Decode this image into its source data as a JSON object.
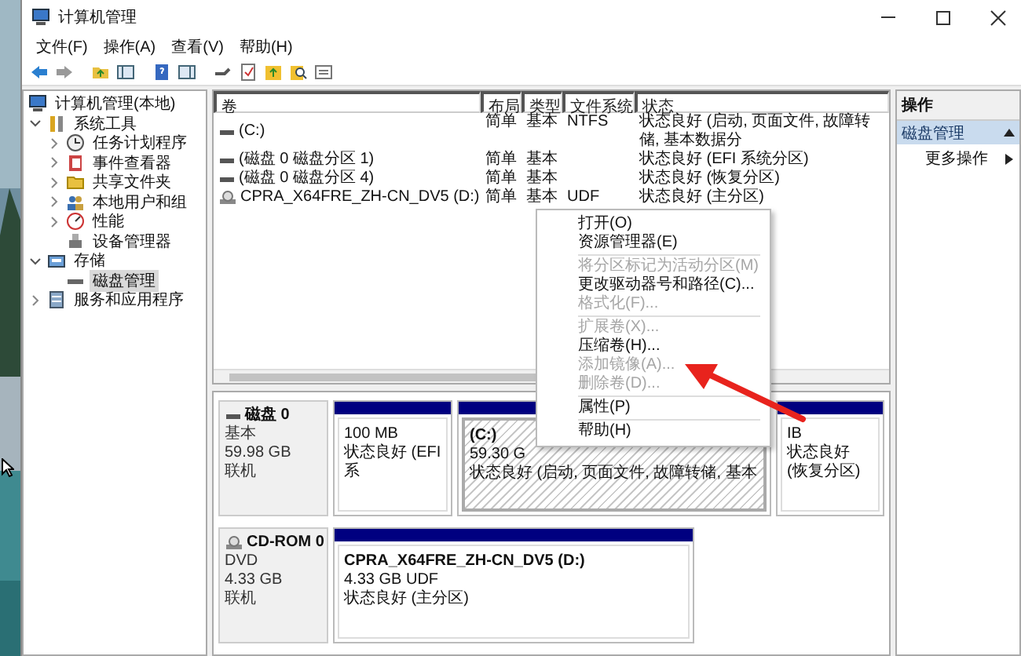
{
  "window": {
    "title": "计算机管理"
  },
  "menu": [
    "文件(F)",
    "操作(A)",
    "查看(V)",
    "帮助(H)"
  ],
  "tree": [
    {
      "label": "计算机管理(本地)",
      "selected": false,
      "children": [
        {
          "label": "系统工具",
          "expanded": true,
          "selected": false,
          "children": [
            {
              "label": "任务计划程序",
              "expanded": false,
              "selected": false
            },
            {
              "label": "事件查看器",
              "expanded": false,
              "selected": false
            },
            {
              "label": "共享文件夹",
              "expanded": false,
              "selected": false
            },
            {
              "label": "本地用户和组",
              "expanded": false,
              "selected": false
            },
            {
              "label": "性能",
              "expanded": false,
              "selected": false
            },
            {
              "label": "设备管理器",
              "selected": false
            }
          ]
        },
        {
          "label": "存储",
          "expanded": true,
          "selected": false,
          "children": [
            {
              "label": "磁盘管理",
              "selected": true
            }
          ]
        },
        {
          "label": "服务和应用程序",
          "expanded": false,
          "selected": false
        }
      ]
    }
  ],
  "volumes": {
    "columns": [
      "卷",
      "布局",
      "类型",
      "文件系统",
      "状态"
    ],
    "rows": [
      {
        "kind": "disk",
        "cells": [
          "(C:)",
          "简单",
          "基本",
          "NTFS",
          "状态良好 (启动, 页面文件, 故障转储, 基本数据分"
        ]
      },
      {
        "kind": "disk",
        "cells": [
          "(磁盘 0 磁盘分区 1)",
          "简单",
          "基本",
          "",
          "状态良好 (EFI 系统分区)"
        ]
      },
      {
        "kind": "disk",
        "cells": [
          "(磁盘 0 磁盘分区 4)",
          "简单",
          "基本",
          "",
          "状态良好 (恢复分区)"
        ]
      },
      {
        "kind": "cd",
        "cells": [
          "CPRA_X64FRE_ZH-CN_DV5 (D:)",
          "简单",
          "基本",
          "UDF",
          "状态良好 (主分区)"
        ]
      }
    ]
  },
  "disks": [
    {
      "kind": "disk",
      "name": "磁盘 0",
      "lines": [
        "基本",
        "59.98 GB",
        "联机"
      ],
      "partitions": [
        {
          "lines": [
            "100 MB",
            "状态良好 (EFI 系"
          ],
          "selected": false
        },
        {
          "title": "(C:)",
          "lines": [
            "59.30 G",
            "状态良好 (启动, 页面文件, 故障转储, 基本"
          ],
          "selected": true
        },
        {
          "lines": [
            "IB",
            "状态良好 (恢复分区)"
          ],
          "selected": false
        }
      ]
    },
    {
      "kind": "cd",
      "name": "CD-ROM 0",
      "lines": [
        "DVD",
        "4.33 GB",
        "联机"
      ],
      "partitions": [
        {
          "title": "CPRA_X64FRE_ZH-CN_DV5  (D:)",
          "lines": [
            "4.33 GB UDF",
            "状态良好 (主分区)"
          ],
          "selected": false
        }
      ]
    }
  ],
  "actions": {
    "title": "操作",
    "section": "磁盘管理",
    "expanded": true,
    "items": [
      "更多操作"
    ]
  },
  "context_menu": {
    "items": [
      {
        "kind": "item",
        "label": "打开(O)",
        "disabled": false
      },
      {
        "kind": "item",
        "label": "资源管理器(E)",
        "disabled": false
      },
      {
        "kind": "separator"
      },
      {
        "kind": "item",
        "label": "将分区标记为活动分区(M)",
        "disabled": true
      },
      {
        "kind": "item",
        "label": "更改驱动器号和路径(C)...",
        "disabled": false
      },
      {
        "kind": "item",
        "label": "格式化(F)...",
        "disabled": true
      },
      {
        "kind": "separator"
      },
      {
        "kind": "item",
        "label": "扩展卷(X)...",
        "disabled": true
      },
      {
        "kind": "item",
        "label": "压缩卷(H)...",
        "disabled": false
      },
      {
        "kind": "item",
        "label": "添加镜像(A)...",
        "disabled": true
      },
      {
        "kind": "item",
        "label": "删除卷(D)...",
        "disabled": true
      },
      {
        "kind": "separator"
      },
      {
        "kind": "item",
        "label": "属性(P)",
        "disabled": false
      },
      {
        "kind": "separator"
      },
      {
        "kind": "item",
        "label": "帮助(H)",
        "disabled": false
      }
    ]
  }
}
